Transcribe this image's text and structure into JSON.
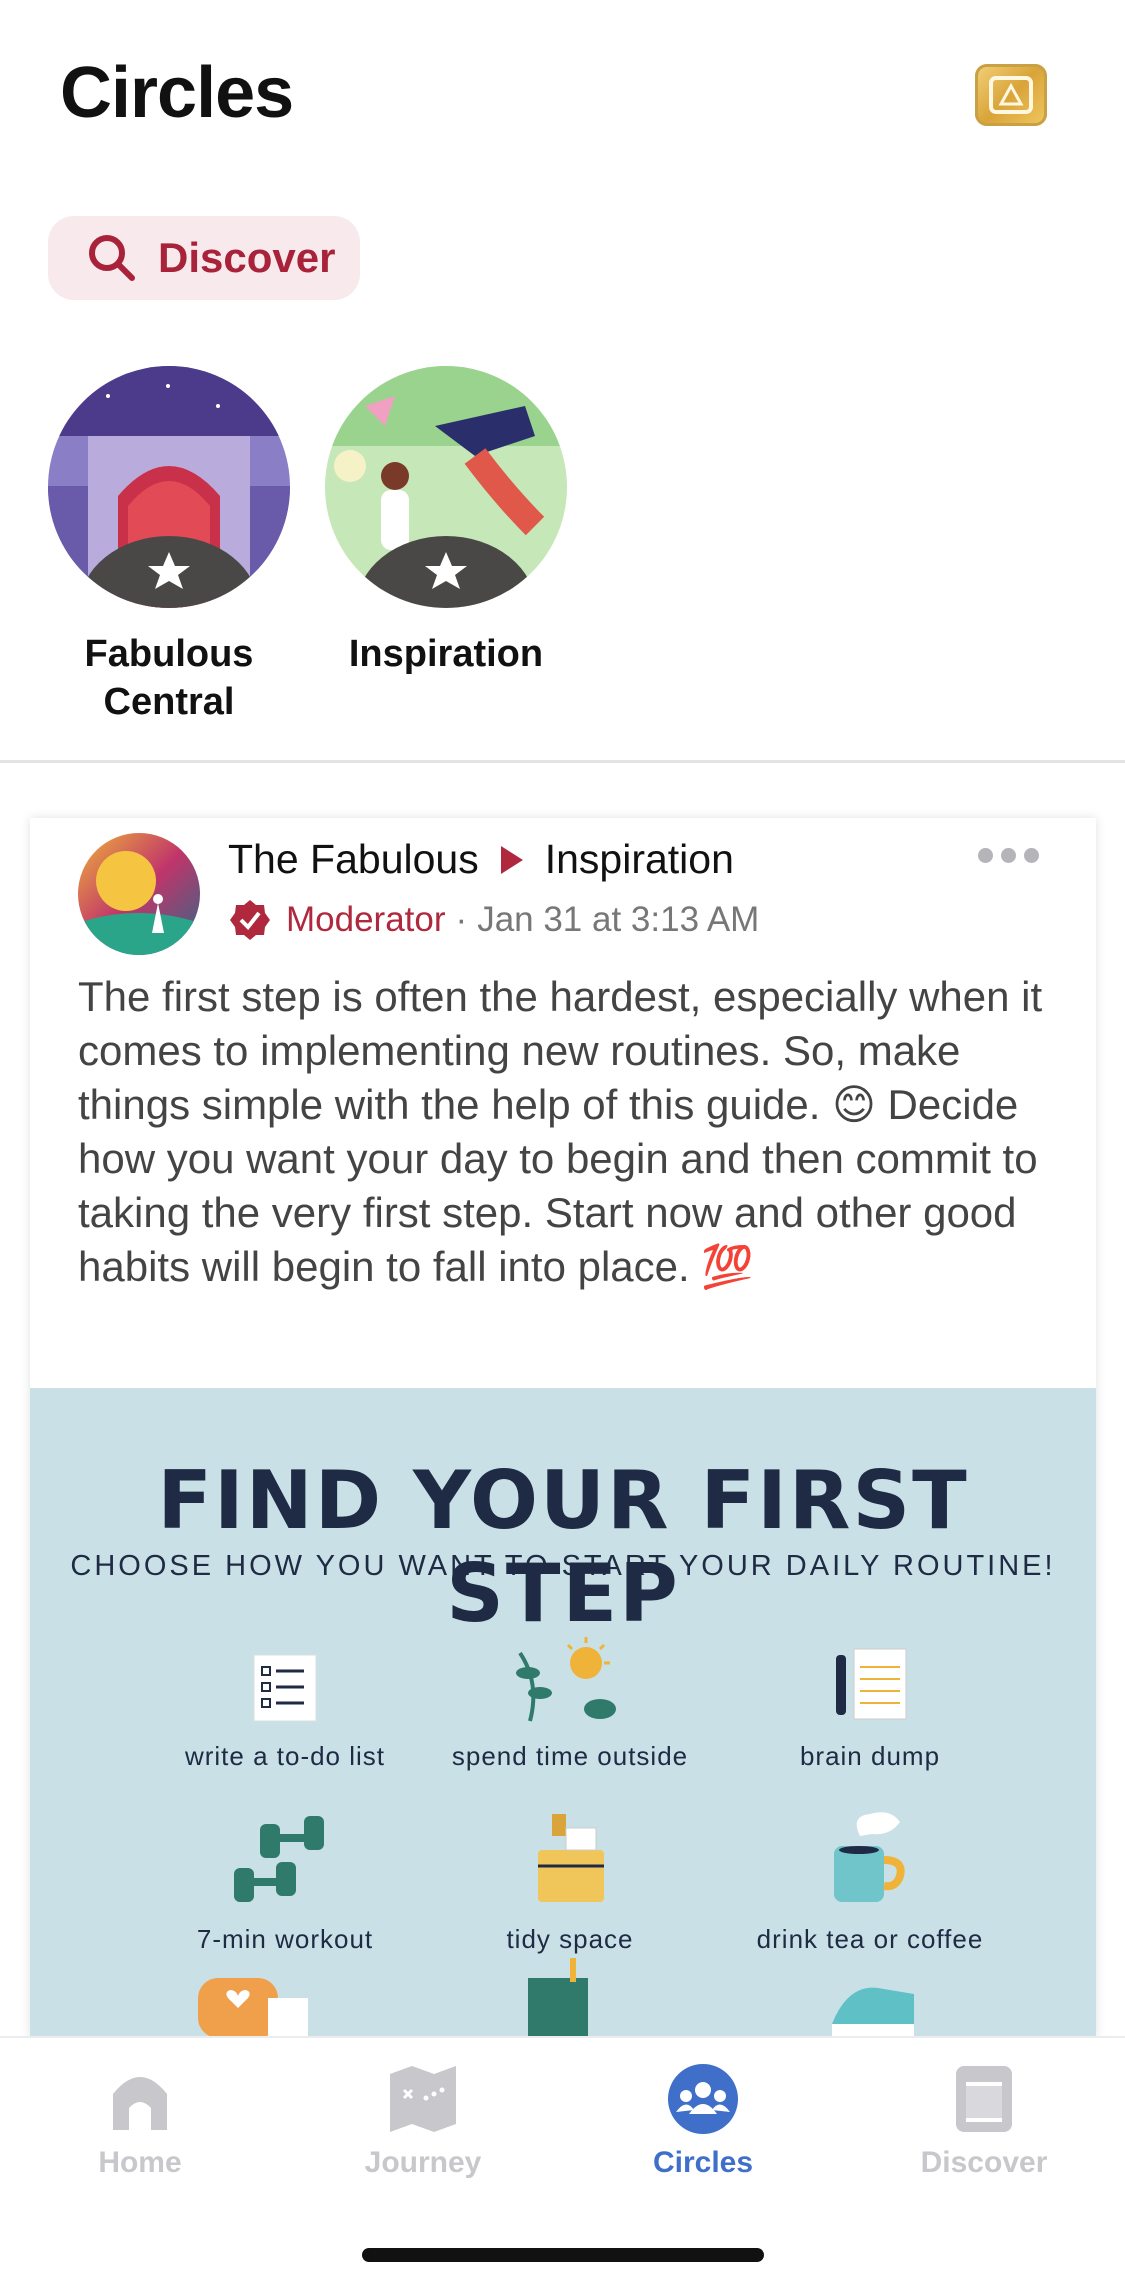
{
  "header": {
    "title": "Circles"
  },
  "discover_chip": {
    "label": "Discover"
  },
  "circles": [
    {
      "name": "Fabulous\nCentral"
    },
    {
      "name": "Inspiration"
    }
  ],
  "post": {
    "author": "The Fabulous",
    "circle": "Inspiration",
    "role": "Moderator",
    "separator": "·",
    "timestamp": "Jan 31 at 3:13 AM",
    "text": "The first step is often the hardest, especially when it comes to implementing new routines. So, make things simple with the help of this guide. 😊 Decide how you want your day to begin and then commit to taking the very first step. Start now and other good habits will begin to fall into place. 💯",
    "image": {
      "title": "FIND YOUR FIRST STEP",
      "subtitle": "CHOOSE HOW YOU WANT TO START YOUR DAILY ROUTINE!",
      "steps": [
        "write a to-do list",
        "spend time outside",
        "brain dump",
        "7-min workout",
        "tidy space",
        "drink tea or coffee"
      ]
    }
  },
  "tabbar": {
    "home": "Home",
    "journey": "Journey",
    "circles": "Circles",
    "discover": "Discover"
  },
  "colors": {
    "accent_red": "#a8223a",
    "active_tab": "#3f6fc9",
    "inactive_tab": "#c7c7cc",
    "infographic_bg": "#c9e1e6"
  }
}
